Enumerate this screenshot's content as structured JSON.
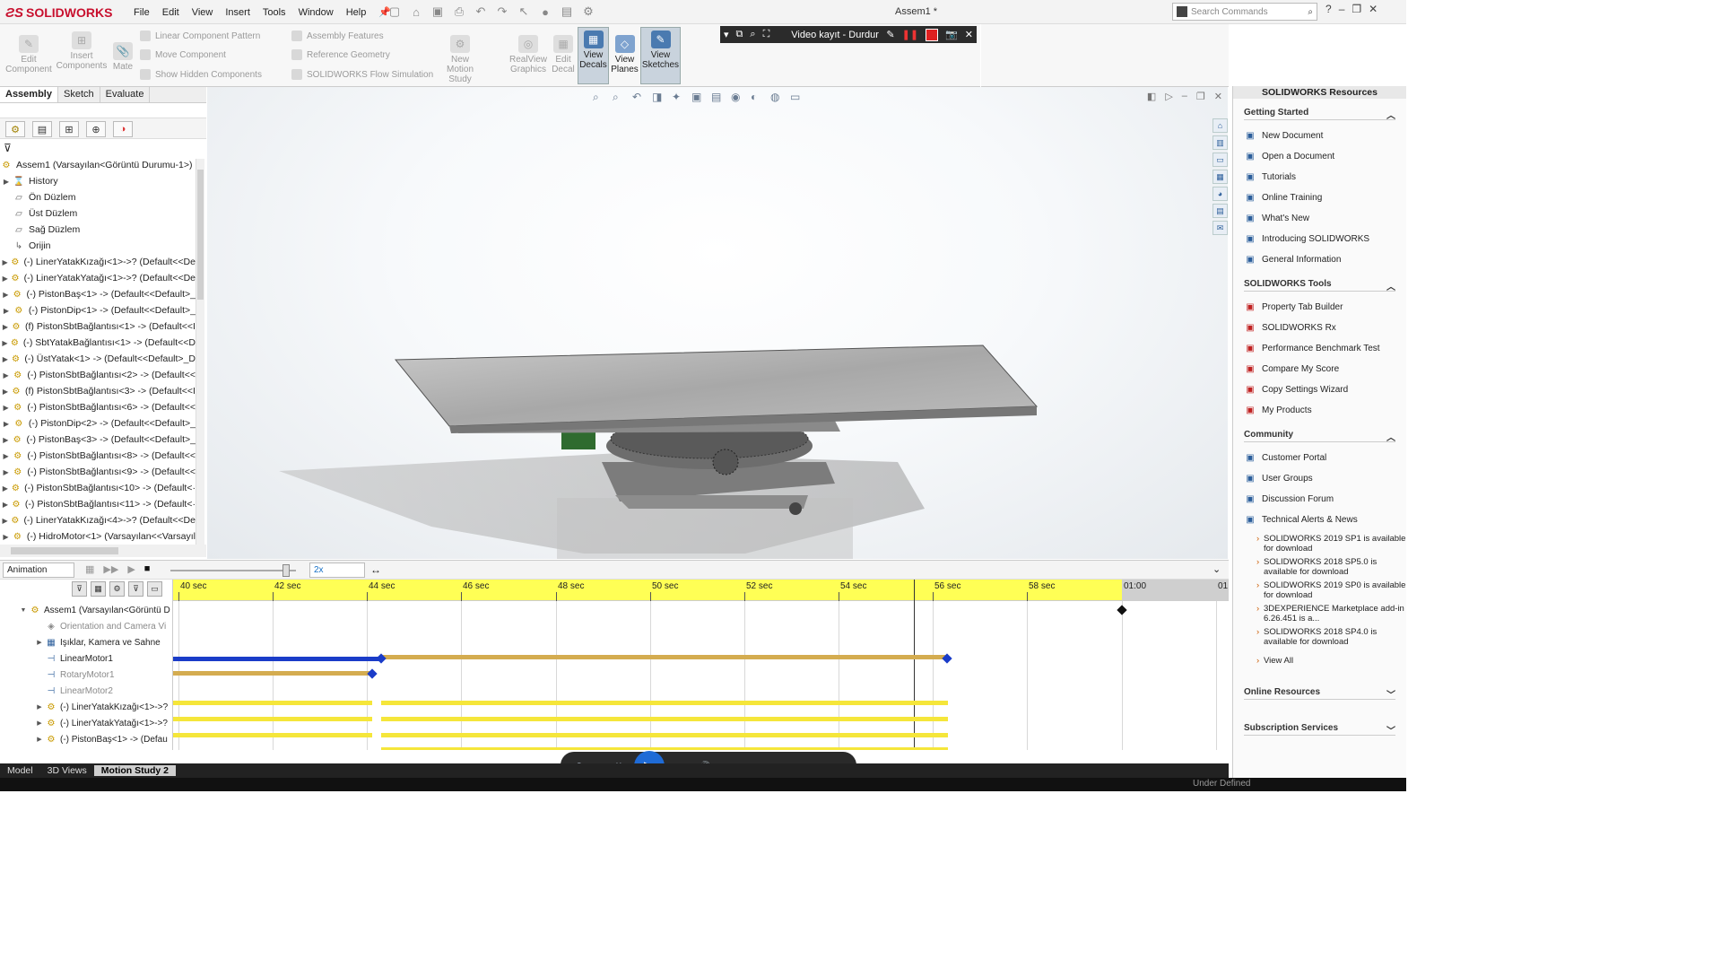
{
  "app": {
    "logo": "SOLIDWORKS",
    "doc_title": "Assem1 *"
  },
  "menu": [
    "File",
    "Edit",
    "View",
    "Insert",
    "Tools",
    "Window",
    "Help"
  ],
  "search": {
    "placeholder": "Search Commands"
  },
  "ribbon": {
    "edit_component": "Edit Component",
    "insert_components": "Insert Components",
    "mate": "Mate",
    "linear_pattern": "Linear Component Pattern",
    "move_component": "Move Component",
    "show_hidden": "Show Hidden Components",
    "assembly_features": "Assembly Features",
    "reference_geometry": "Reference Geometry",
    "flow_simulation": "SOLIDWORKS Flow Simulation",
    "new_motion_study": "New Motion Study",
    "realview": "RealView Graphics",
    "edit_decal": "Edit Decal",
    "view_decals": "View Decals",
    "view_planes": "View Planes",
    "view_sketches": "View Sketches"
  },
  "video_bar": {
    "title": "Video kayıt - Durdur"
  },
  "tabs": [
    "Assembly",
    "Sketch",
    "Evaluate"
  ],
  "tree": {
    "root": "Assem1  (Varsayılan<Görüntü Durumu-1>)",
    "items": [
      {
        "label": "History",
        "type": "history",
        "arrow": true
      },
      {
        "label": "Ön Düzlem",
        "type": "plane",
        "arrow": false
      },
      {
        "label": "Üst Düzlem",
        "type": "plane",
        "arrow": false
      },
      {
        "label": "Sağ Düzlem",
        "type": "plane",
        "arrow": false
      },
      {
        "label": "Orijin",
        "type": "origin",
        "arrow": false
      },
      {
        "label": "(-) LinerYatakKızağı<1>->? (Default<<De",
        "type": "comp",
        "arrow": true
      },
      {
        "label": "(-) LinerYatakYatağı<1>->? (Default<<De",
        "type": "comp",
        "arrow": true
      },
      {
        "label": "(-) PistonBaş<1> -> (Default<<Default>_",
        "type": "comp",
        "arrow": true
      },
      {
        "label": "(-) PistonDip<1> -> (Default<<Default>_",
        "type": "comp",
        "arrow": true
      },
      {
        "label": "(f) PistonSbtBağlantısı<1> -> (Default<<I",
        "type": "comp",
        "arrow": true
      },
      {
        "label": "(-) SbtYatakBağlantısı<1> -> (Default<<D",
        "type": "comp",
        "arrow": true
      },
      {
        "label": "(-) ÜstYatak<1> -> (Default<<Default>_D",
        "type": "comp",
        "arrow": true
      },
      {
        "label": "(-) PistonSbtBağlantısı<2> -> (Default<<",
        "type": "comp",
        "arrow": true
      },
      {
        "label": "(f) PistonSbtBağlantısı<3> -> (Default<<I",
        "type": "comp",
        "arrow": true
      },
      {
        "label": "(-) PistonSbtBağlantısı<6> -> (Default<<",
        "type": "comp",
        "arrow": true
      },
      {
        "label": "(-) PistonDip<2> -> (Default<<Default>_",
        "type": "comp",
        "arrow": true
      },
      {
        "label": "(-) PistonBaş<3> -> (Default<<Default>_",
        "type": "comp",
        "arrow": true
      },
      {
        "label": "(-) PistonSbtBağlantısı<8> -> (Default<<",
        "type": "comp",
        "arrow": true
      },
      {
        "label": "(-) PistonSbtBağlantısı<9> -> (Default<<",
        "type": "comp",
        "arrow": true
      },
      {
        "label": "(-) PistonSbtBağlantısı<10> -> (Default<·",
        "type": "comp",
        "arrow": true
      },
      {
        "label": "(-) PistonSbtBağlantısı<11> -> (Default<·",
        "type": "comp",
        "arrow": true
      },
      {
        "label": "(-) LinerYatakKızağı<4>->? (Default<<De",
        "type": "comp",
        "arrow": true
      },
      {
        "label": "(-) HidroMotor<1> (Varsayılan<<Varsayıl",
        "type": "comp",
        "arrow": true
      }
    ]
  },
  "resources": {
    "title": "SOLIDWORKS Resources",
    "getting_started": {
      "title": "Getting Started",
      "items": [
        "New Document",
        "Open a Document",
        "Tutorials",
        "Online Training",
        "What's New",
        "Introducing SOLIDWORKS",
        "General Information"
      ]
    },
    "tools": {
      "title": "SOLIDWORKS Tools",
      "items": [
        "Property Tab Builder",
        "SOLIDWORKS Rx",
        "Performance Benchmark Test",
        "Compare My Score",
        "Copy Settings Wizard",
        "My Products"
      ]
    },
    "community": {
      "title": "Community",
      "items": [
        "Customer Portal",
        "User Groups",
        "Discussion Forum",
        "Technical Alerts & News"
      ]
    },
    "news": [
      "SOLIDWORKS 2019 SP1 is available for download",
      "SOLIDWORKS 2018 SP5.0 is available for download",
      "SOLIDWORKS 2019 SP0 is available for download",
      "3DEXPERIENCE Marketplace add-in 6.26.451 is a...",
      "SOLIDWORKS 2018 SP4.0 is available for download"
    ],
    "view_all": "View All",
    "online_resources": "Online Resources",
    "subscription": "Subscription Services"
  },
  "motion": {
    "study_type": "Animation",
    "speed": "2x",
    "time_labels": [
      "40 sec",
      "42 sec",
      "44 sec",
      "46 sec",
      "48 sec",
      "50 sec",
      "52 sec",
      "54 sec",
      "56 sec",
      "58 sec",
      "01:00",
      "01"
    ],
    "rows": [
      {
        "label": "Assem1  (Varsayılan<Görüntü D",
        "icon": "asm",
        "arrow": "down",
        "dim": false
      },
      {
        "label": "Orientation and Camera Vi",
        "icon": "cam",
        "arrow": "",
        "dim": true
      },
      {
        "label": "Işıklar, Kamera ve Sahne",
        "icon": "light",
        "arrow": "right",
        "dim": false
      },
      {
        "label": "LinearMotor1",
        "icon": "motor",
        "arrow": "",
        "dim": false
      },
      {
        "label": "RotaryMotor1",
        "icon": "motor",
        "arrow": "",
        "dim": true
      },
      {
        "label": "LinearMotor2",
        "icon": "motor",
        "arrow": "",
        "dim": true
      },
      {
        "label": "(-) LinerYatakKızağı<1>->?",
        "icon": "comp",
        "arrow": "right",
        "dim": false
      },
      {
        "label": "(-) LinerYatakYatağı<1>->?",
        "icon": "comp",
        "arrow": "right",
        "dim": false
      },
      {
        "label": "(-) PistonBaş<1> -> (Defau",
        "icon": "comp",
        "arrow": "right",
        "dim": false
      }
    ]
  },
  "bottom_tabs": [
    "Model",
    "3D Views",
    "Motion Study 2"
  ],
  "status": {
    "text": "Under Defined"
  }
}
